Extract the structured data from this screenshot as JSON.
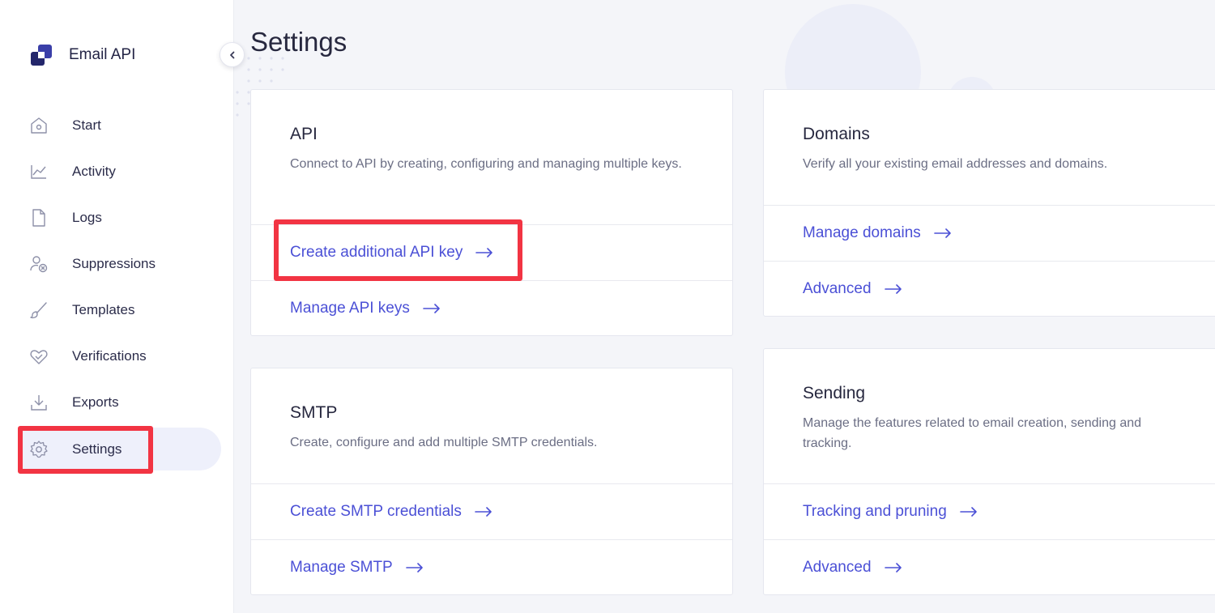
{
  "app": {
    "name": "Email API",
    "accent": "#4b50d6",
    "highlight_color": "#f23443"
  },
  "sidebar": {
    "items": [
      {
        "label": "Start",
        "icon": "home-icon"
      },
      {
        "label": "Activity",
        "icon": "chart-icon"
      },
      {
        "label": "Logs",
        "icon": "file-icon"
      },
      {
        "label": "Suppressions",
        "icon": "user-block-icon"
      },
      {
        "label": "Templates",
        "icon": "brush-icon"
      },
      {
        "label": "Verifications",
        "icon": "heart-check-icon"
      },
      {
        "label": "Exports",
        "icon": "download-icon"
      },
      {
        "label": "Settings",
        "icon": "gear-icon",
        "active": true
      }
    ]
  },
  "page": {
    "title": "Settings"
  },
  "cards": {
    "api": {
      "title": "API",
      "description": "Connect to API by creating, configuring and managing multiple keys.",
      "links": [
        "Create additional API key",
        "Manage API keys"
      ]
    },
    "domains": {
      "title": "Domains",
      "description": "Verify all your existing email addresses and domains.",
      "links": [
        "Manage domains",
        "Advanced"
      ]
    },
    "smtp": {
      "title": "SMTP",
      "description": "Create, configure and add multiple SMTP credentials.",
      "links": [
        "Create SMTP credentials",
        "Manage SMTP"
      ]
    },
    "sending": {
      "title": "Sending",
      "description": "Manage the features related to email creation, sending and tracking.",
      "links": [
        "Tracking and pruning",
        "Advanced"
      ]
    }
  }
}
